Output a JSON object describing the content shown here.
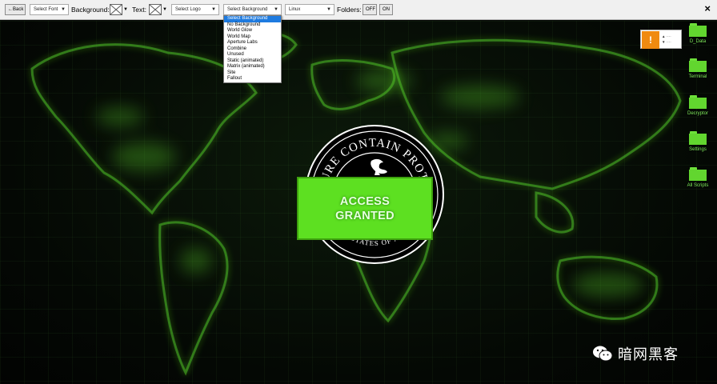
{
  "toolbar": {
    "back_label": "←Back",
    "font_select": "Select Font",
    "background_label": "Background:",
    "text_label": "Text:",
    "logo_select": "Select Logo",
    "background_select": "Select Background",
    "os_select": "Linux",
    "folders_label": "Folders:",
    "folders_off": "OFF",
    "folders_on": "ON",
    "close_label": "×"
  },
  "dropdown": {
    "options": [
      "Select Background",
      "No Background",
      "World Glow",
      "World Map",
      "Aperture Labs",
      "Combine",
      "Unused",
      "Static (animated)",
      "Matrix (animated)",
      "Site",
      "Fallout"
    ],
    "selected_index": 0
  },
  "seal": {
    "top_text": "SECURE CONTAIN PROTECT",
    "bottom_text": "UNITED STATES OF AMERICA"
  },
  "access": {
    "line1": "ACCESS",
    "line2": "GRANTED"
  },
  "notification": {
    "badge": "!",
    "rows": [
      "▲ ····",
      "▼ ····"
    ]
  },
  "desktop_icons": [
    {
      "label": "D_Data",
      "icon": "folder-icon"
    },
    {
      "label": "Terminal",
      "icon": "folder-icon"
    },
    {
      "label": "Decryptor",
      "icon": "folder-icon"
    },
    {
      "label": "Settings",
      "icon": "folder-icon"
    },
    {
      "label": "All Scripts",
      "icon": "folder-icon"
    }
  ],
  "watermark": {
    "text": "暗网黑客",
    "icon": "wechat-icon"
  },
  "colors": {
    "accent_green": "#5de021",
    "folder_green": "#62d62f",
    "map_glow": "#55c425",
    "selection_blue": "#1e7be0",
    "badge_orange": "#f08a10"
  }
}
